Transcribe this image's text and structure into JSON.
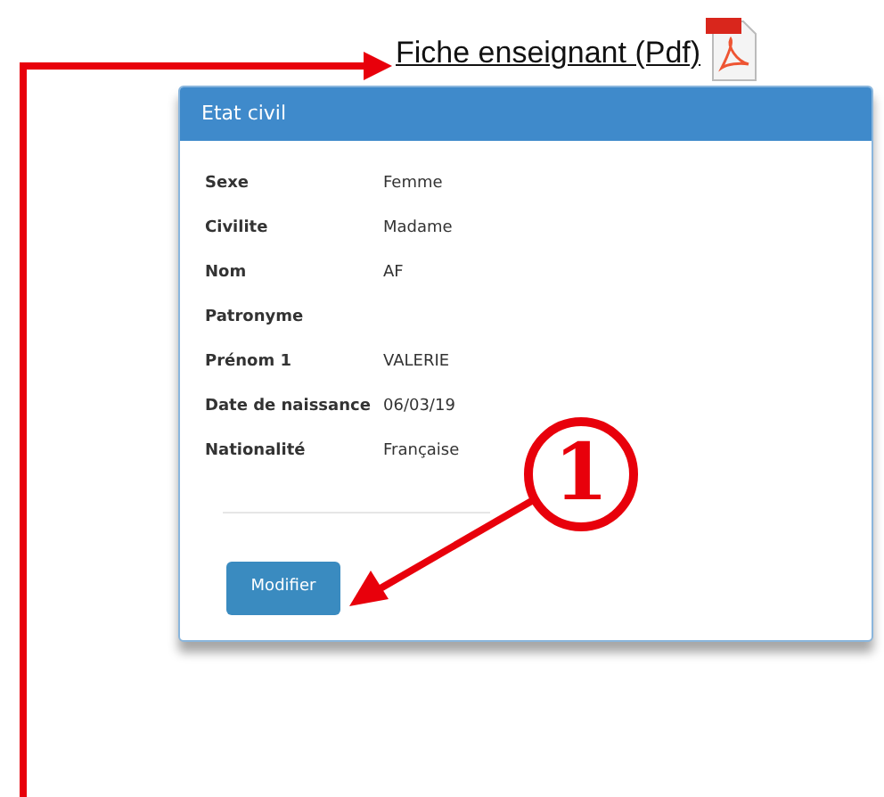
{
  "document_link": {
    "label": "Fiche enseignant (Pdf)"
  },
  "panel": {
    "title": "Etat civil",
    "fields": [
      {
        "label": "Sexe",
        "value": "Femme"
      },
      {
        "label": "Civilite",
        "value": "Madame"
      },
      {
        "label": "Nom",
        "value": "AF"
      },
      {
        "label": "Patronyme"
      },
      {
        "label": "Prénom 1",
        "value": "VALERIE"
      },
      {
        "label": "Date de naissance",
        "value": "06/03/19"
      },
      {
        "label": "Nationalité",
        "value": "Française"
      }
    ],
    "button": "Modifier"
  },
  "callout": {
    "number": "1"
  }
}
